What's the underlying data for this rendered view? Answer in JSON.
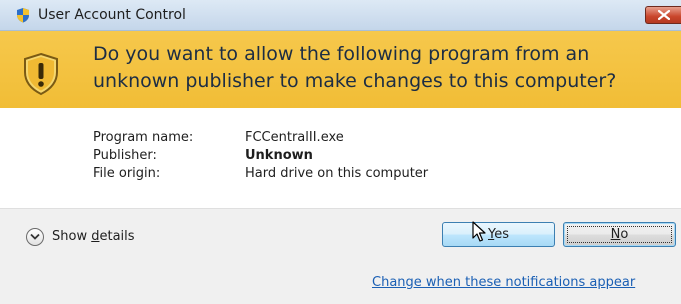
{
  "window": {
    "title": "User Account Control",
    "close_icon": "close-icon"
  },
  "banner": {
    "message": "Do you want to allow the following program from an unknown publisher to make changes to this computer?",
    "icon": "shield-icon"
  },
  "details": {
    "program_label": "Program name:",
    "program_value": "FCCentralII.exe",
    "publisher_label": "Publisher:",
    "publisher_value": "Unknown",
    "origin_label": "File origin:",
    "origin_value": "Hard drive on this computer"
  },
  "footer": {
    "show_details_prefix": "Show ",
    "show_details_underlined": "d",
    "show_details_suffix": "etails",
    "yes_underlined": "Y",
    "yes_suffix": "es",
    "no_underlined": "N",
    "no_suffix": "o"
  },
  "link": {
    "text": "Change when these notifications appear"
  },
  "colors": {
    "banner": "#f1bd36",
    "titlebar": "#c4d6ea",
    "link": "#1a5fb4",
    "close": "#c9452b"
  }
}
